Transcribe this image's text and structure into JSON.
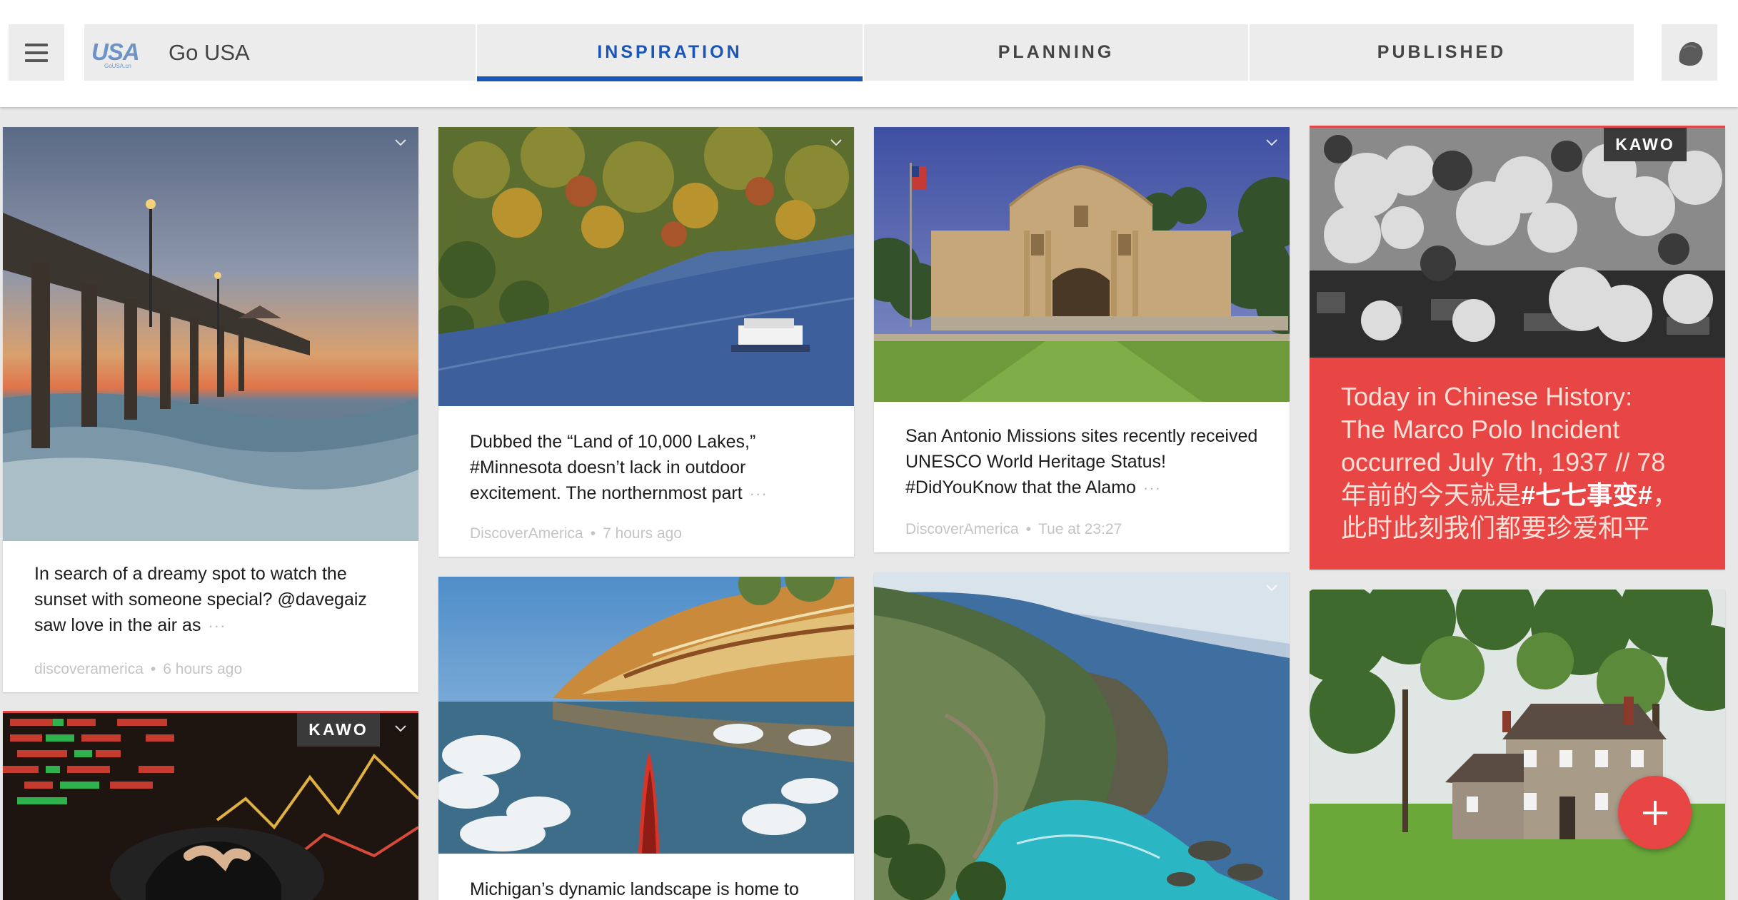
{
  "header": {
    "brand_name": "Go USA",
    "logo_text": "USA",
    "logo_sub": "GoUSA.cn",
    "tabs": [
      {
        "label": "INSPIRATION",
        "active": true
      },
      {
        "label": "PLANNING",
        "active": false
      },
      {
        "label": "PUBLISHED",
        "active": false
      }
    ]
  },
  "cards": {
    "pier": {
      "text": "In search of a dreamy spot to watch the sunset with someone special? @davegaiz saw love in the air as",
      "more": "···",
      "source": "discoveramerica",
      "time": "6 hours ago"
    },
    "lakes": {
      "text": "Dubbed the “Land of 10,000 Lakes,” #Minnesota doesn’t lack in outdoor excitement. The northernmost part",
      "more": "···",
      "source": "DiscoverAmerica",
      "time": "7 hours ago"
    },
    "alamo": {
      "text": "San Antonio Missions sites recently received UNESCO World Heritage Status! #DidYouKnow that the Alamo",
      "more": "···",
      "source": "DiscoverAmerica",
      "time": "Tue at 23:27"
    },
    "history": {
      "badge": "KAWO",
      "text_line1": "Today in Chinese History:",
      "text_line2": "The Marco Polo Incident",
      "text_line3": "occurred July 7th, 1937 // 78",
      "text_line4_pre": "年前的今天就是",
      "text_line4_bold": "#七七事变#",
      "text_line4_post": "，",
      "text_line5": "此时此刻我们都要珍爱和平"
    },
    "stock": {
      "badge": "KAWO"
    },
    "michigan": {
      "text": "Michigan’s dynamic landscape is home to"
    }
  },
  "colors": {
    "accent": "#1a56b8",
    "kawo_red": "#e84545",
    "badge_bg": "#3a3a3a"
  },
  "icons": {
    "menu": "hamburger-icon",
    "avatar": "user-avatar-icon",
    "fab": "plus-icon",
    "chevron": "chevron-down-icon"
  }
}
